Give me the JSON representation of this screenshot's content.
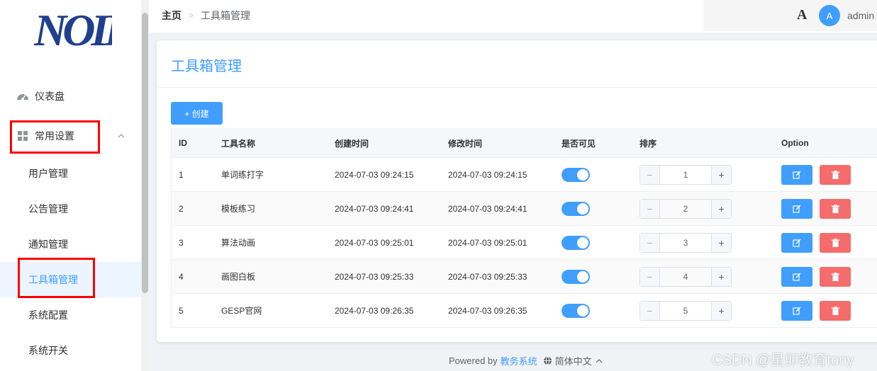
{
  "logo_text": "NOIP",
  "sidebar": {
    "dashboard": "仪表盘",
    "common_settings": "常用设置",
    "items": [
      "用户管理",
      "公告管理",
      "通知管理",
      "工具箱管理",
      "系统配置",
      "系统开关"
    ]
  },
  "header": {
    "home": "主页",
    "current": "工具箱管理",
    "font_icon": "A",
    "avatar": "A",
    "username": "admin"
  },
  "page": {
    "title": "工具箱管理",
    "create_label": "+ 创建"
  },
  "table": {
    "headers": [
      "ID",
      "工具名称",
      "创建时间",
      "修改时间",
      "是否可见",
      "排序",
      "Option"
    ],
    "rows": [
      {
        "id": "1",
        "name": "单词练打字",
        "created": "2024-07-03 09:24:15",
        "modified": "2024-07-03 09:24:15",
        "visible": true,
        "sort": "1"
      },
      {
        "id": "2",
        "name": "模板练习",
        "created": "2024-07-03 09:24:41",
        "modified": "2024-07-03 09:24:41",
        "visible": true,
        "sort": "2"
      },
      {
        "id": "3",
        "name": "算法动画",
        "created": "2024-07-03 09:25:01",
        "modified": "2024-07-03 09:25:01",
        "visible": true,
        "sort": "3"
      },
      {
        "id": "4",
        "name": "画图白板",
        "created": "2024-07-03 09:25:33",
        "modified": "2024-07-03 09:25:33",
        "visible": true,
        "sort": "4"
      },
      {
        "id": "5",
        "name": "GESP官网",
        "created": "2024-07-03 09:26:35",
        "modified": "2024-07-03 09:26:35",
        "visible": true,
        "sort": "5"
      }
    ]
  },
  "footer": {
    "powered_by": "Powered by",
    "system": "教务系统",
    "language": "简体中文"
  },
  "watermark": "CSDN @星卯教育tony",
  "colors": {
    "primary": "#409eff",
    "danger": "#f56c6c",
    "highlight": "#ff0000"
  }
}
